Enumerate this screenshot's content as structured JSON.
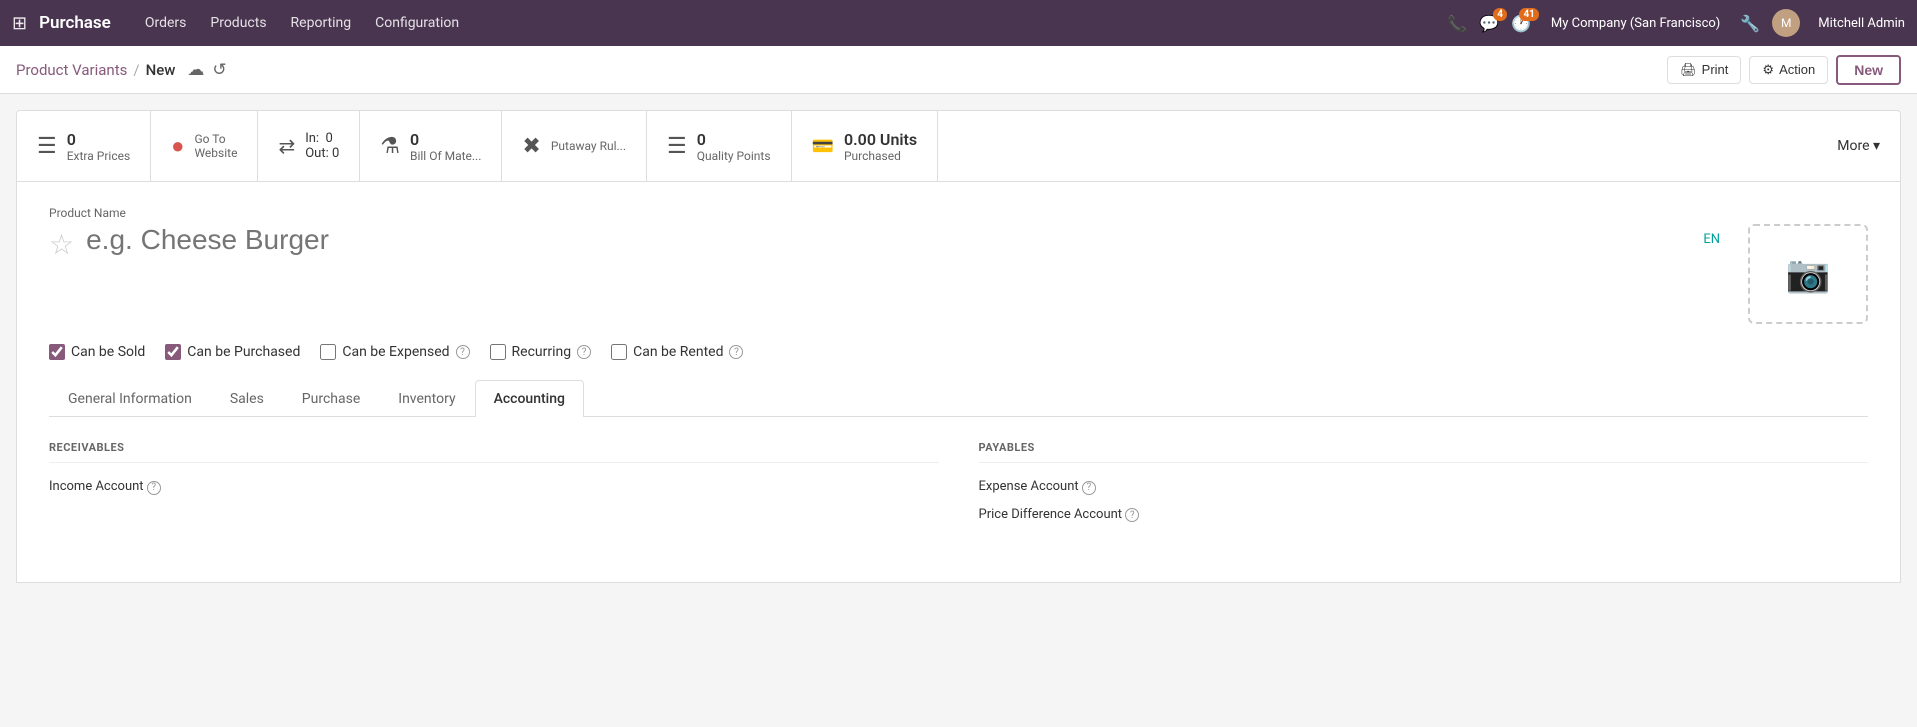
{
  "app": {
    "name": "Purchase",
    "nav_links": [
      "Orders",
      "Products",
      "Reporting",
      "Configuration"
    ]
  },
  "topbar": {
    "phone_icon": "📞",
    "chat_badge": "4",
    "activity_badge": "41",
    "company": "My Company (San Francisco)",
    "wrench_icon": "🔧",
    "user_name": "Mitchell Admin"
  },
  "breadcrumb": {
    "parent": "Product Variants",
    "current": "New",
    "save_icon": "☁",
    "discard_icon": "↺"
  },
  "action_buttons": {
    "print": "Print",
    "action": "Action",
    "new": "New"
  },
  "stat_bar": [
    {
      "id": "extra-prices",
      "icon": "☰",
      "count": "0",
      "label": "Extra Prices",
      "icon_color": "normal"
    },
    {
      "id": "go-to-website",
      "icon": "●",
      "label1": "Go To",
      "label2": "Website",
      "icon_color": "red"
    },
    {
      "id": "in-out",
      "in_count": "0",
      "out_count": "0",
      "icon": "⇄"
    },
    {
      "id": "bill-of-materials",
      "icon": "⚗",
      "count": "0",
      "label": "Bill Of Mate..."
    },
    {
      "id": "putaway-rules",
      "icon": "✖",
      "label": "Putaway Rul..."
    },
    {
      "id": "quality-points",
      "icon": "☰",
      "count": "0",
      "label": "Quality Points"
    },
    {
      "id": "units-purchased",
      "icon": "💳",
      "count": "0.00",
      "label": "Units Purchased"
    }
  ],
  "more_label": "More ▾",
  "form": {
    "product_name_label": "Product Name",
    "product_name_placeholder": "e.g. Cheese Burger",
    "lang_btn": "EN",
    "photo_icon": "📷"
  },
  "checkboxes": [
    {
      "id": "can-be-sold",
      "label": "Can be Sold",
      "checked": true,
      "has_help": false
    },
    {
      "id": "can-be-purchased",
      "label": "Can be Purchased",
      "checked": true,
      "has_help": false
    },
    {
      "id": "can-be-expensed",
      "label": "Can be Expensed",
      "checked": false,
      "has_help": true
    },
    {
      "id": "recurring",
      "label": "Recurring",
      "checked": false,
      "has_help": true
    },
    {
      "id": "can-be-rented",
      "label": "Can be Rented",
      "checked": false,
      "has_help": true
    }
  ],
  "tabs": [
    {
      "id": "general-information",
      "label": "General Information",
      "active": false
    },
    {
      "id": "sales",
      "label": "Sales",
      "active": false
    },
    {
      "id": "purchase",
      "label": "Purchase",
      "active": false
    },
    {
      "id": "inventory",
      "label": "Inventory",
      "active": false
    },
    {
      "id": "accounting",
      "label": "Accounting",
      "active": true
    }
  ],
  "accounting_tab": {
    "receivables_header": "RECEIVABLES",
    "payables_header": "PAYABLES",
    "income_account_label": "Income Account",
    "income_account_help": "?",
    "expense_account_label": "Expense Account",
    "expense_account_help": "?",
    "price_diff_label": "Price Difference Account",
    "price_diff_help": "?"
  }
}
